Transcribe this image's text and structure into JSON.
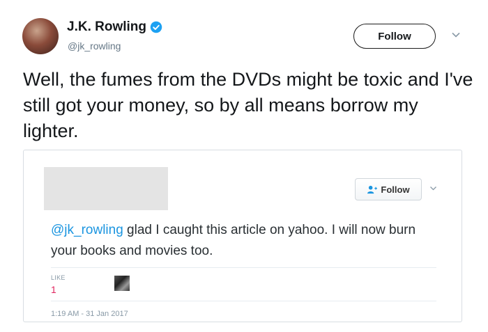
{
  "tweet": {
    "author": {
      "display_name": "J.K. Rowling",
      "handle": "@jk_rowling",
      "verified_icon": "verified-badge-icon"
    },
    "follow_label": "Follow",
    "text": "Well, the fumes from the DVDs might be toxic and I've still got your money, so by all means borrow my lighter."
  },
  "embedded_tweet": {
    "follow_label": "Follow",
    "mention": "@jk_rowling",
    "text": " glad I caught this article on yahoo. I will now burn your books and movies too.",
    "like_label": "LIKE",
    "like_count": "1",
    "timestamp": "1:19 AM - 31 Jan 2017"
  },
  "colors": {
    "link_blue": "#1b95e0",
    "verified_blue": "#1da1f2",
    "like_pink": "#e0245e"
  }
}
